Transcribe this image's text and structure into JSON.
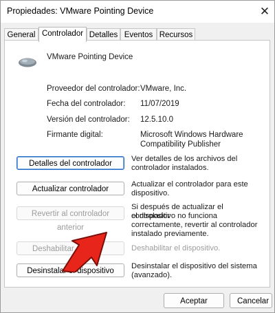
{
  "window": {
    "title": "Propiedades: VMware Pointing Device",
    "close_glyph": "✕"
  },
  "tabs": [
    {
      "label": "General"
    },
    {
      "label": "Controlador",
      "active": true
    },
    {
      "label": "Detalles"
    },
    {
      "label": "Eventos"
    },
    {
      "label": "Recursos"
    }
  ],
  "device": {
    "name": "VMware Pointing Device",
    "icon": "mouse-icon"
  },
  "properties": {
    "provider_label": "Proveedor del controlador:",
    "provider_value": "VMware, Inc.",
    "date_label": "Fecha del controlador:",
    "date_value": "11/07/2019",
    "version_label": "Versión del controlador:",
    "version_value": "12.5.10.0",
    "signer_label": "Firmante digital:",
    "signer_value_line1": "Microsoft Windows Hardware",
    "signer_value_line2": "Compatibility Publisher"
  },
  "actions": {
    "details_label": "Detalles del controlador",
    "details_desc_line1": "Ver detalles de los archivos del",
    "details_desc_line2": "controlador instalados.",
    "update_label": "Actualizar controlador",
    "update_desc_line1": "Actualizar el controlador para este",
    "update_desc_line2": "dispositivo.",
    "rollback_label": "Revertir al controlador anterior",
    "rollback_desc_line1": "Si después de actualizar el controlador",
    "rollback_desc_line2": "el dispositivo no funciona",
    "rollback_desc_line3": "correctamente, revertir al controlador",
    "rollback_desc_line4": "instalado previamente.",
    "disable_label": "Deshabilitar dis",
    "disable_desc": "Deshabilitar el dispositivo.",
    "uninstall_label": "Desinstalar el dispositivo",
    "uninstall_desc_line1": "Desinstalar el dispositivo del sistema",
    "uninstall_desc_line2": "(avanzado)."
  },
  "footer": {
    "accept_label": "Aceptar",
    "cancel_label": "Cancelar"
  },
  "colors": {
    "accent": "#2a6fc9",
    "arrow": "#e8251b",
    "disabled_text": "#9c9c9c"
  }
}
